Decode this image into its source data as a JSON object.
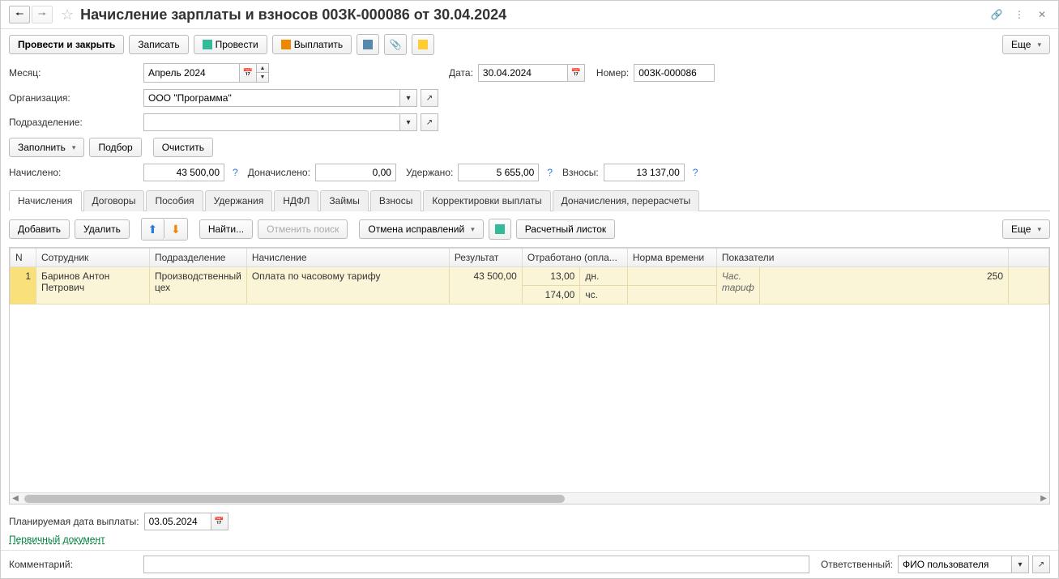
{
  "header": {
    "title": "Начисление зарплаты и взносов 00ЗК-000086 от 30.04.2024"
  },
  "toolbar": {
    "post_close": "Провести и закрыть",
    "write": "Записать",
    "post": "Провести",
    "payout": "Выплатить",
    "more": "Еще"
  },
  "fields": {
    "month_label": "Месяц:",
    "month_value": "Апрель 2024",
    "date_label": "Дата:",
    "date_value": "30.04.2024",
    "number_label": "Номер:",
    "number_value": "00ЗК-000086",
    "org_label": "Организация:",
    "org_value": "ООО \"Программа\"",
    "dept_label": "Подразделение:",
    "dept_value": "",
    "fill_btn": "Заполнить",
    "pick_btn": "Подбор",
    "clear_btn": "Очистить",
    "accrued_label": "Начислено:",
    "accrued_value": "43 500,00",
    "extra_accrued_label": "Доначислено:",
    "extra_accrued_value": "0,00",
    "held_label": "Удержано:",
    "held_value": "5 655,00",
    "contrib_label": "Взносы:",
    "contrib_value": "13 137,00"
  },
  "tabs": [
    "Начисления",
    "Договоры",
    "Пособия",
    "Удержания",
    "НДФЛ",
    "Займы",
    "Взносы",
    "Корректировки выплаты",
    "Доначисления, перерасчеты"
  ],
  "grid_toolbar": {
    "add": "Добавить",
    "delete": "Удалить",
    "find": "Найти...",
    "cancel_find": "Отменить поиск",
    "cancel_fix": "Отмена исправлений",
    "payslip": "Расчетный листок",
    "more": "Еще"
  },
  "columns": [
    "N",
    "Сотрудник",
    "Подразделение",
    "Начисление",
    "Результат",
    "Отработано (опла...",
    "Норма времени",
    "Показатели"
  ],
  "row": {
    "n": "1",
    "employee": "Баринов Антон Петрович",
    "dept": "Производственный цех",
    "accrual": "Оплата по часовому тарифу",
    "result": "43 500,00",
    "worked_days": "13,00",
    "worked_days_unit": "дн.",
    "worked_hours": "174,00",
    "worked_hours_unit": "чс.",
    "indicator_name": "Час. тариф",
    "indicator_value": "250"
  },
  "bottom": {
    "plan_date_label": "Планируемая дата выплаты:",
    "plan_date_value": "03.05.2024",
    "primary_doc": "Первичный документ",
    "comment_label": "Комментарий:",
    "responsible_label": "Ответственный:",
    "responsible_value": "ФИО пользователя"
  }
}
